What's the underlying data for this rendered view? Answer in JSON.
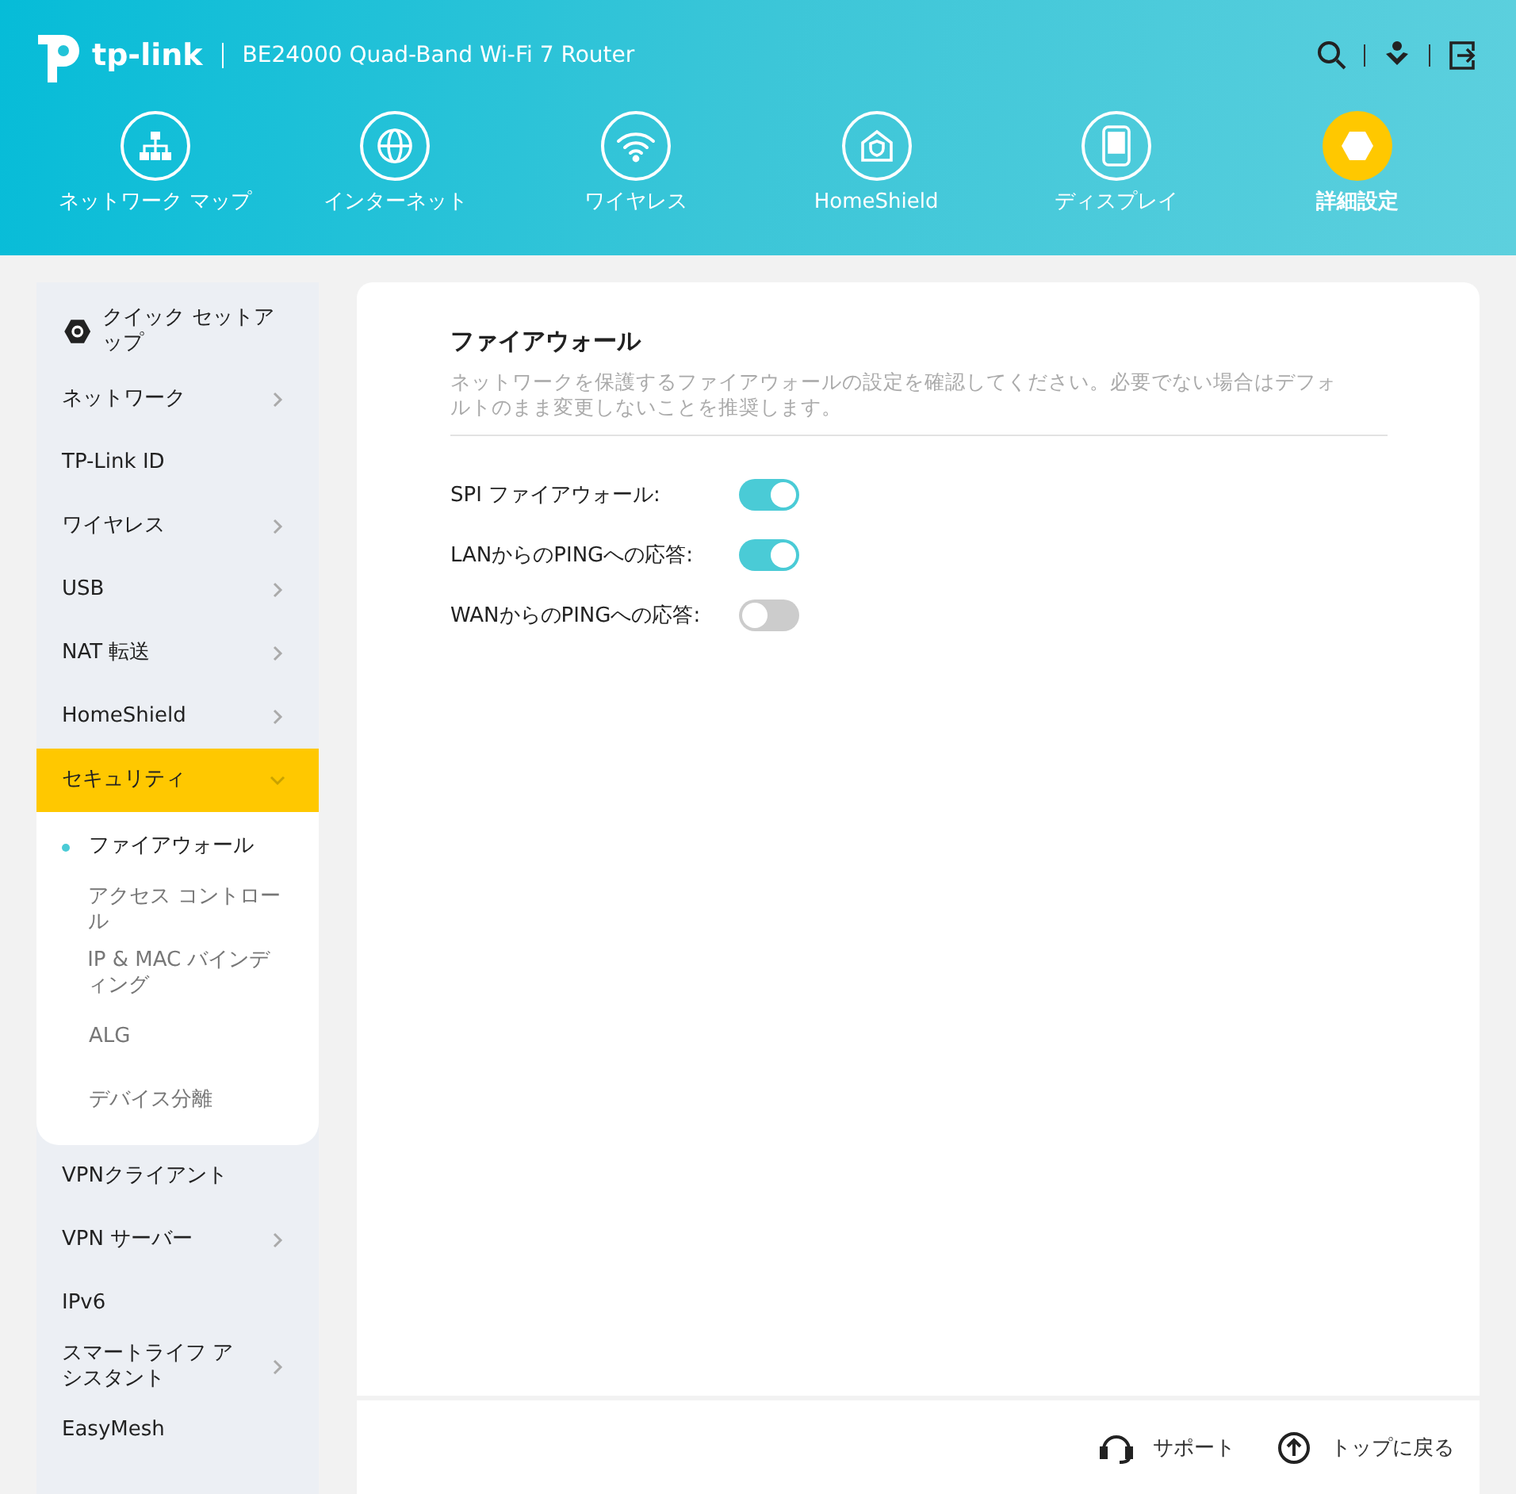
{
  "header": {
    "logo": "tp-link",
    "model": "BE24000 Quad-Band Wi-Fi 7 Router"
  },
  "nav": [
    {
      "label": "ネットワーク マップ",
      "selected": false
    },
    {
      "label": "インターネット",
      "selected": false
    },
    {
      "label": "ワイヤレス",
      "selected": false
    },
    {
      "label": "HomeShield",
      "selected": false
    },
    {
      "label": "ディスプレイ",
      "selected": false
    },
    {
      "label": "詳細設定",
      "selected": true
    }
  ],
  "sidebar": {
    "quick_setup": "クイック セットアップ",
    "items": [
      {
        "label": "ネットワーク",
        "expanded": false,
        "selected": false
      },
      {
        "label": "TP-Link ID",
        "selected": false
      },
      {
        "label": "ワイヤレス",
        "expanded": false,
        "selected": false
      },
      {
        "label": "USB",
        "expanded": false,
        "selected": false
      },
      {
        "label": "NAT 転送",
        "expanded": false,
        "selected": false
      },
      {
        "label": "HomeShield",
        "expanded": false,
        "selected": false
      },
      {
        "label": "セキュリティ",
        "expanded": true,
        "selected": true,
        "children": [
          {
            "label": "ファイアウォール",
            "selected": true
          },
          {
            "label": "アクセス コントロール",
            "selected": false
          },
          {
            "label": "IP & MAC バインディング",
            "selected": false
          },
          {
            "label": "ALG",
            "selected": false
          },
          {
            "label": "デバイス分離",
            "selected": false
          }
        ]
      },
      {
        "label": "VPNクライアント",
        "selected": false
      },
      {
        "label": "VPN サーバー",
        "expanded": false,
        "selected": false
      },
      {
        "label": "IPv6",
        "selected": false
      },
      {
        "label": "スマートライフ アシスタント",
        "expanded": false,
        "selected": false
      },
      {
        "label": "EasyMesh",
        "selected": false
      }
    ]
  },
  "panel": {
    "title": "ファイアウォール",
    "description": "ネットワークを保護するファイアウォールの設定を確認してください。必要でない場合はデフォルトのまま変更しないことを推奨します。",
    "settings": [
      {
        "label": "SPI ファイアウォール:",
        "on": true
      },
      {
        "label": "LANからのPINGへの応答:",
        "on": true
      },
      {
        "label": "WANからのPINGへの応答:",
        "on": false
      }
    ]
  },
  "footer": {
    "support": "サポート",
    "back_to_top": "トップに戻る"
  }
}
